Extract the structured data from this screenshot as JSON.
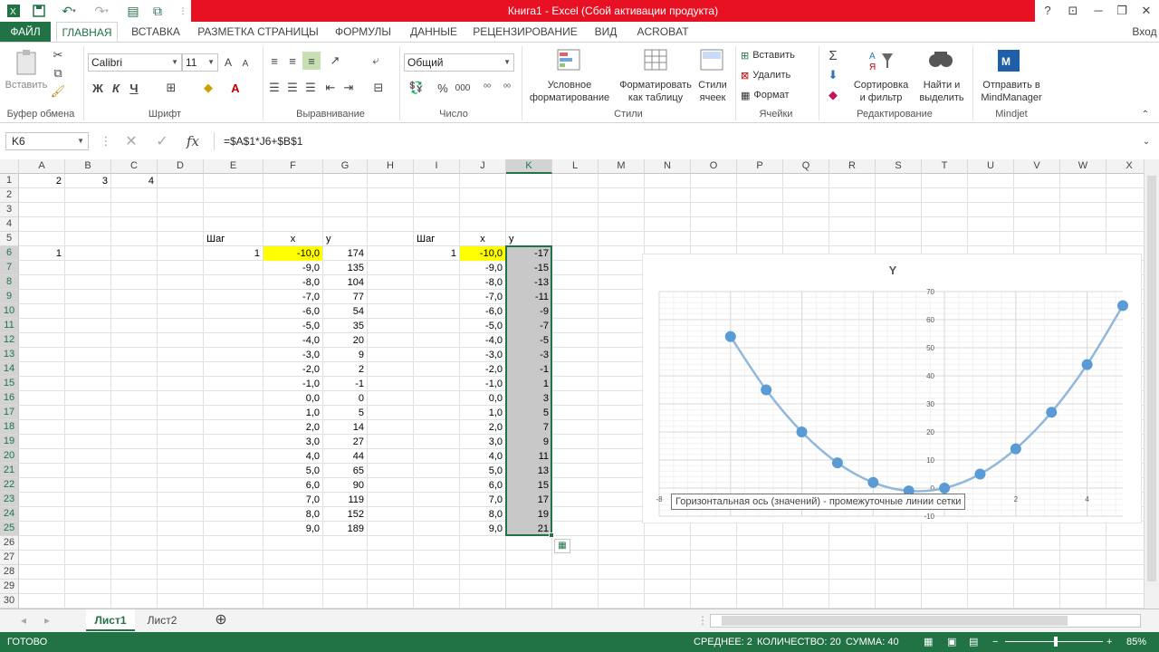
{
  "window": {
    "title": "Книга1 - Excel (Сбой активации продукта)",
    "help": "?",
    "account": "Вход"
  },
  "tabs": [
    "ФАЙЛ",
    "ГЛАВНАЯ",
    "ВСТАВКА",
    "РАЗМЕТКА СТРАНИЦЫ",
    "ФОРМУЛЫ",
    "ДАННЫЕ",
    "РЕЦЕНЗИРОВАНИЕ",
    "ВИД",
    "ACROBAT"
  ],
  "ribbon": {
    "clipboard": {
      "paste": "Вставить",
      "label": "Буфер обмена"
    },
    "font": {
      "name": "Calibri",
      "size": "11",
      "bold": "Ж",
      "italic": "К",
      "underline": "Ч",
      "grow": "A",
      "shrink": "A",
      "label": "Шрифт"
    },
    "alignment": {
      "label": "Выравнивание"
    },
    "number": {
      "format": "Общий",
      "percent": "%",
      "thousands": "000",
      "label": "Число"
    },
    "styles": {
      "conditional": [
        "Условное",
        "форматирование"
      ],
      "table": [
        "Форматировать",
        "как таблицу"
      ],
      "cell": [
        "Стили",
        "ячеек"
      ],
      "label": "Стили"
    },
    "cells": {
      "insert": "Вставить",
      "delete": "Удалить",
      "format": "Формат",
      "label": "Ячейки"
    },
    "editing": {
      "sort": [
        "Сортировка",
        "и фильтр"
      ],
      "find": [
        "Найти и",
        "выделить"
      ],
      "label": "Редактирование"
    },
    "mindjet": {
      "send": [
        "Отправить в",
        "MindManager"
      ],
      "label": "Mindjet"
    }
  },
  "formula_bar": {
    "name_box": "K6",
    "formula": "=$A$1*J6+$B$1"
  },
  "columns": [
    "A",
    "B",
    "C",
    "D",
    "E",
    "F",
    "G",
    "H",
    "I",
    "J",
    "K",
    "L",
    "M",
    "N",
    "O",
    "P",
    "Q",
    "R",
    "S",
    "T",
    "U",
    "V",
    "W",
    "X"
  ],
  "rows": [
    "1",
    "2",
    "3",
    "4",
    "5",
    "6",
    "7",
    "8",
    "9",
    "10",
    "11",
    "12",
    "13",
    "14",
    "15",
    "16",
    "17",
    "18",
    "19",
    "20",
    "21",
    "22",
    "23",
    "24",
    "25",
    "26",
    "27",
    "28",
    "29",
    "30"
  ],
  "cells": {
    "A1": "2",
    "B1": "3",
    "C1": "4",
    "E5": "Шаг",
    "F5": "x",
    "G5": "y",
    "I5": "Шаг",
    "J5": "x",
    "K5": "y",
    "A6": "1",
    "E6": "1",
    "I6": "1",
    "F": [
      "-10,0",
      "-9,0",
      "-8,0",
      "-7,0",
      "-6,0",
      "-5,0",
      "-4,0",
      "-3,0",
      "-2,0",
      "-1,0",
      "0,0",
      "1,0",
      "2,0",
      "3,0",
      "4,0",
      "5,0",
      "6,0",
      "7,0",
      "8,0",
      "9,0"
    ],
    "G": [
      "174",
      "135",
      "104",
      "77",
      "54",
      "35",
      "20",
      "9",
      "2",
      "-1",
      "0",
      "5",
      "14",
      "27",
      "44",
      "65",
      "90",
      "119",
      "152",
      "189"
    ],
    "J": [
      "-10,0",
      "-9,0",
      "-8,0",
      "-7,0",
      "-6,0",
      "-5,0",
      "-4,0",
      "-3,0",
      "-2,0",
      "-1,0",
      "0,0",
      "1,0",
      "2,0",
      "3,0",
      "4,0",
      "5,0",
      "6,0",
      "7,0",
      "8,0",
      "9,0"
    ],
    "K": [
      "-17",
      "-15",
      "-13",
      "-11",
      "-9",
      "-7",
      "-5",
      "-3",
      "-1",
      "1",
      "3",
      "5",
      "7",
      "9",
      "11",
      "13",
      "15",
      "17",
      "19",
      "21"
    ]
  },
  "chart_data": {
    "type": "scatter",
    "title": "Y",
    "xlabel": "",
    "ylabel": "",
    "series": [
      {
        "values": [
          {
            "x": -6,
            "y": 54
          },
          {
            "x": -5,
            "y": 35
          },
          {
            "x": -4,
            "y": 20
          },
          {
            "x": -3,
            "y": 9
          },
          {
            "x": -2,
            "y": 2
          },
          {
            "x": -1,
            "y": -1
          },
          {
            "x": 0,
            "y": 0
          },
          {
            "x": 1,
            "y": 5
          },
          {
            "x": 2,
            "y": 14
          },
          {
            "x": 3,
            "y": 27
          },
          {
            "x": 4,
            "y": 44
          },
          {
            "x": 5,
            "y": 65
          }
        ]
      }
    ],
    "y_ticks": [
      "70",
      "60",
      "50",
      "40",
      "30",
      "20",
      "10",
      "0",
      "-10"
    ],
    "x_ticks": [
      "-8",
      "2",
      "4"
    ],
    "ylim": [
      -10,
      70
    ],
    "xlim": [
      -8,
      5
    ],
    "grid": true,
    "line_color": "#8fb8dc",
    "marker_color": "#5b9bd5"
  },
  "tooltip": "Горизонтальная ось (значений)  - промежуточные линии сетки",
  "sheet_tabs": [
    "Лист1",
    "Лист2"
  ],
  "status": {
    "ready": "ГОТОВО",
    "average": "СРЕДНЕЕ: 2",
    "count": "КОЛИЧЕСТВО: 20",
    "sum": "СУММА: 40",
    "zoom": "85%"
  },
  "colors": {
    "excel_green": "#217346",
    "title_red": "#e81123",
    "highlight_yellow": "#ffff00"
  }
}
